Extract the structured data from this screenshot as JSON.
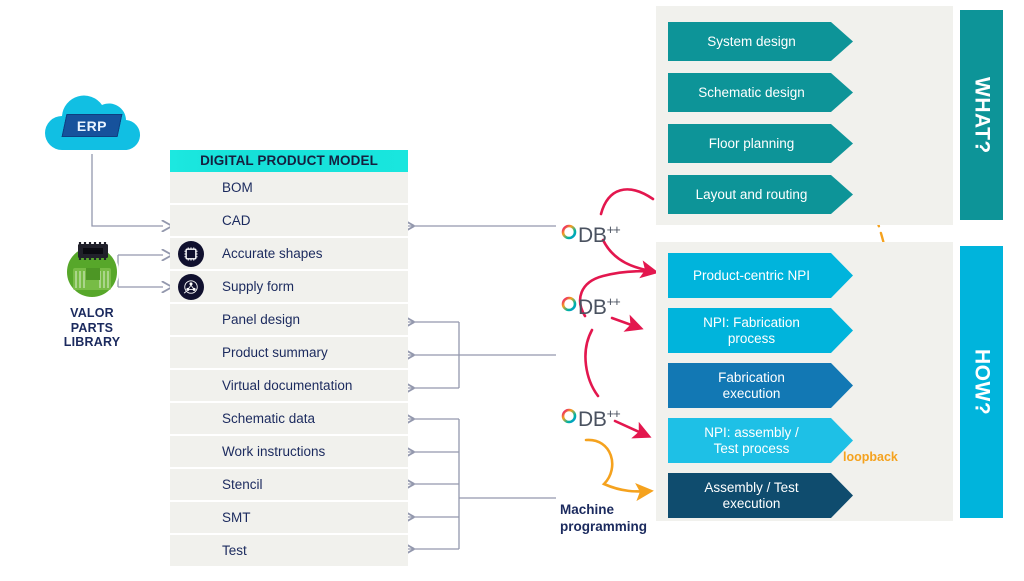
{
  "colors": {
    "teal_dark": "#0d9498",
    "cyan_bright": "#00b4dc",
    "cyan_light": "#1ec0e6",
    "blue_mid": "#1278b4",
    "blue_deep": "#0f4c6e",
    "panel_bg": "#f1f1ed",
    "row_bg": "#f1f1ed",
    "header_gradient_from": "#1ce8e0",
    "header_gradient_to": "#19e6de",
    "crimson": "#e3174e",
    "orange": "#f5a21e",
    "gray_connector": "#9398ad",
    "navy_text": "#1b2a5e",
    "erp_cloud": "#11bfe3",
    "erp_badge": "#16529c",
    "valor_green": "#57a72a",
    "icon_circle": "#10102e"
  },
  "erp": {
    "label": "ERP",
    "icon": "cloud-icon"
  },
  "valor": {
    "icon": "valor-parts-library-icon",
    "label_lines": [
      "VALOR",
      "PARTS",
      "LIBRARY"
    ],
    "label_full": "VALOR PARTS LIBRARY"
  },
  "digital_product_model": {
    "title": "DIGITAL PRODUCT MODEL",
    "rows": [
      {
        "label": "BOM",
        "icon": null,
        "has_arrow": false
      },
      {
        "label": "CAD",
        "icon": null,
        "has_arrow": true
      },
      {
        "label": "Accurate shapes",
        "icon": "chip-icon",
        "has_arrow": false
      },
      {
        "label": "Supply form",
        "icon": "supply-network-icon",
        "has_arrow": false
      },
      {
        "label": "Panel design",
        "icon": null,
        "has_arrow": true
      },
      {
        "label": "Product summary",
        "icon": null,
        "has_arrow": true
      },
      {
        "label": "Virtual documentation",
        "icon": null,
        "has_arrow": true
      },
      {
        "label": "Schematic data",
        "icon": null,
        "has_arrow": true
      },
      {
        "label": "Work instructions",
        "icon": null,
        "has_arrow": true
      },
      {
        "label": "Stencil",
        "icon": null,
        "has_arrow": true
      },
      {
        "label": "SMT",
        "icon": null,
        "has_arrow": true
      },
      {
        "label": "Test",
        "icon": null,
        "has_arrow": true
      }
    ]
  },
  "odb_badges": [
    {
      "id": "odb-1",
      "text": "DB",
      "superscript": "++",
      "ring": "odb-ring-icon"
    },
    {
      "id": "odb-2",
      "text": "DB",
      "superscript": "++",
      "ring": "odb-ring-icon"
    },
    {
      "id": "odb-3",
      "text": "DB",
      "superscript": "++",
      "ring": "odb-ring-icon"
    }
  ],
  "what_panel": {
    "sidebar_label": "WHAT?",
    "sidebar_color": "#0d9498",
    "steps": [
      {
        "label": "System design",
        "color": "#0d9498"
      },
      {
        "label": "Schematic design",
        "color": "#0d9498"
      },
      {
        "label": "Floor planning",
        "color": "#0d9498"
      },
      {
        "label": "Layout and routing",
        "color": "#0d9498"
      }
    ]
  },
  "how_panel": {
    "sidebar_label": "HOW?",
    "sidebar_color": "#00b4dc",
    "steps": [
      {
        "label": "Product-centric NPI",
        "color": "#00b4dc"
      },
      {
        "label": "NPI: Fabrication\nprocess",
        "color": "#00b4dc"
      },
      {
        "label": "Fabrication\nexecution",
        "color": "#1278b4"
      },
      {
        "label": "NPI: assembly /\nTest  process",
        "color": "#1ec0e6"
      },
      {
        "label": "Assembly / Test\nexecution",
        "color": "#0f4c6e"
      }
    ]
  },
  "annotations": {
    "loopback": "loopback",
    "machine_programming": "Machine\nprogramming"
  }
}
